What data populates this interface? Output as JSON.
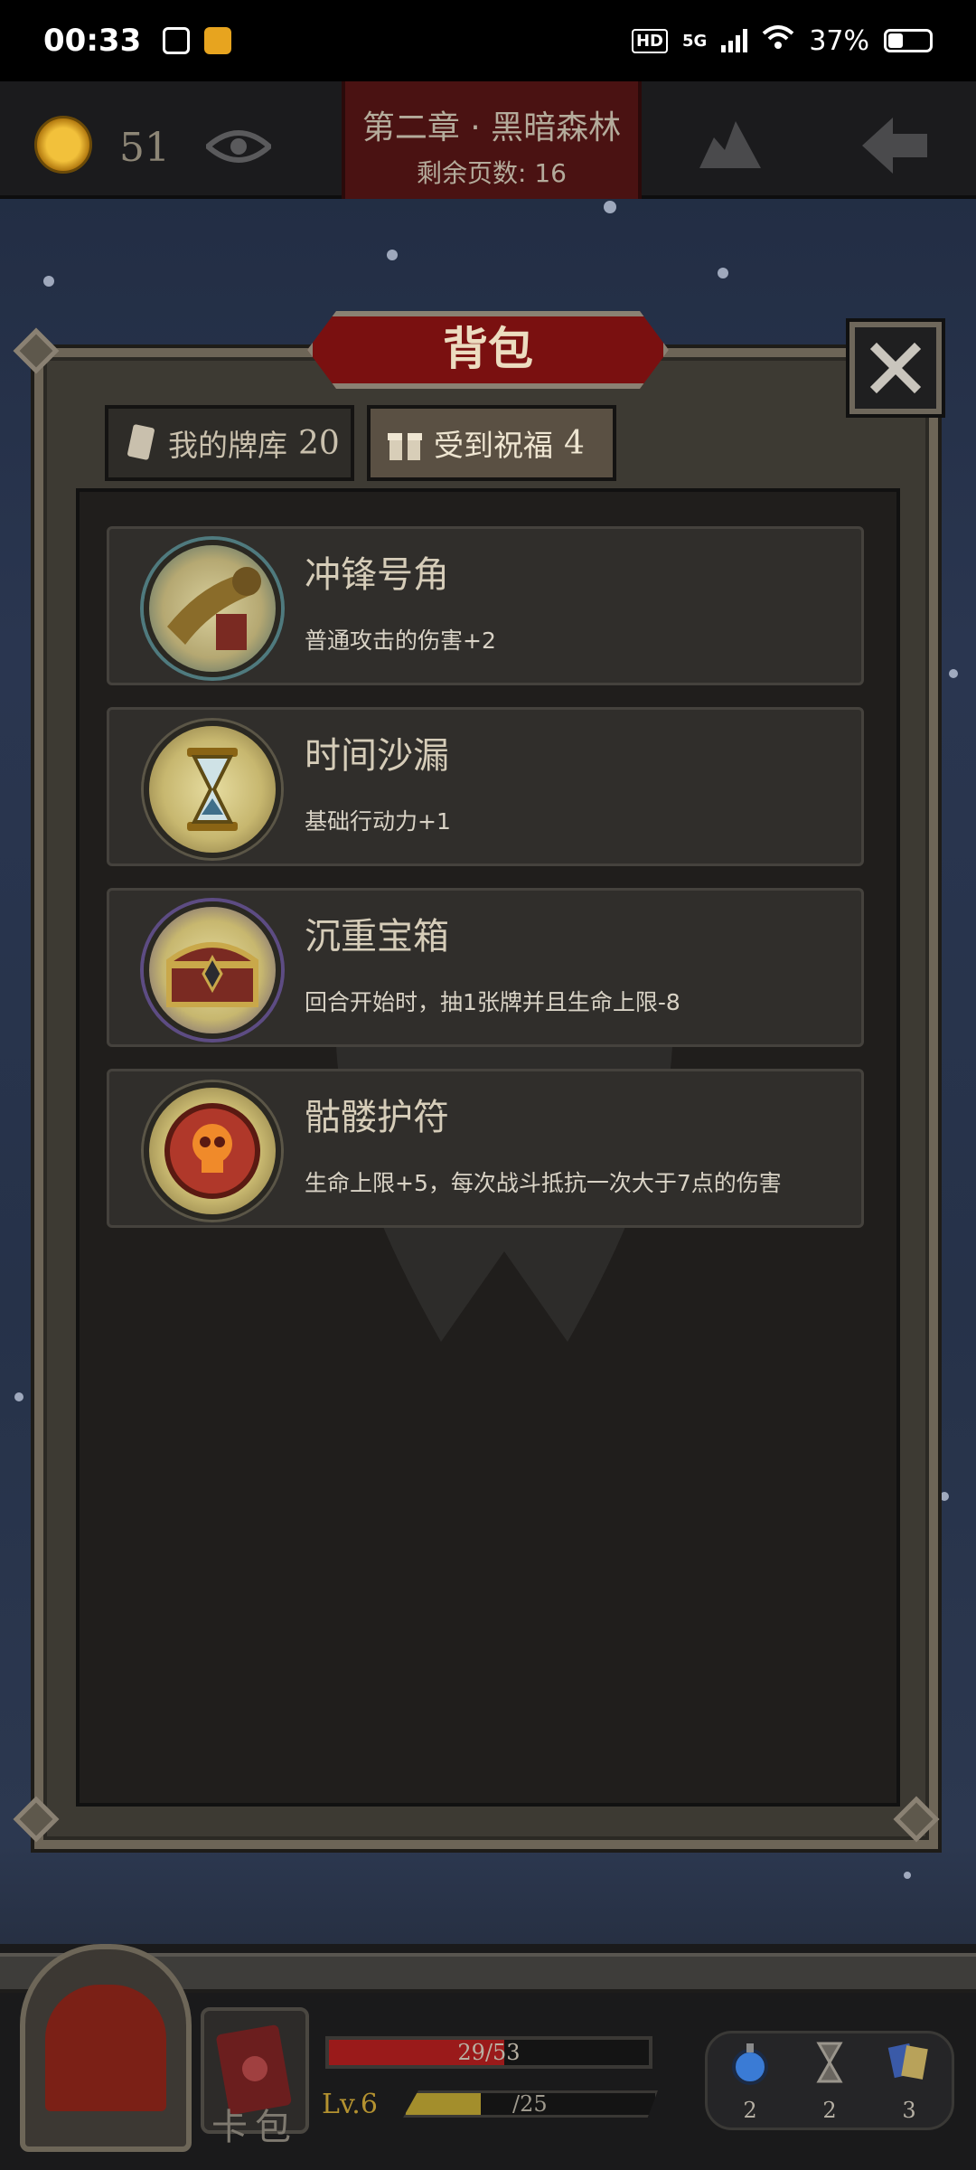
{
  "status_bar": {
    "time": "00:33",
    "network": "5G",
    "hd_label": "HD",
    "battery": "37%"
  },
  "top_bar": {
    "coins": "51",
    "chapter_title": "第二章 · 黑暗森林",
    "pages_remaining": "剩余页数: 16"
  },
  "panel": {
    "title": "背包",
    "tabs": [
      {
        "label": "我的牌库",
        "count": "20",
        "icon": "card-icon",
        "active": false
      },
      {
        "label": "受到祝福",
        "count": "4",
        "icon": "gift-icon",
        "active": true
      }
    ],
    "items": [
      {
        "name": "冲锋号角",
        "desc": "普通攻击的伤害+2",
        "icon": "horn-icon"
      },
      {
        "name": "时间沙漏",
        "desc": "基础行动力+1",
        "icon": "hourglass-icon"
      },
      {
        "name": "沉重宝箱",
        "desc": "回合开始时，抽1张牌并且生命上限-8",
        "icon": "chest-icon"
      },
      {
        "name": "骷髅护符",
        "desc": "生命上限+5，每次战斗抵抗一次大于7点的伤害",
        "icon": "skull-amulet-icon"
      }
    ]
  },
  "hud": {
    "deck_label": "卡包",
    "hp_text": "29/53",
    "hp": 29,
    "hp_max": 53,
    "level": "Lv.6",
    "xp_text": "/25",
    "xp_fraction": 0.3,
    "resources": [
      {
        "icon": "potion-icon",
        "count": "2"
      },
      {
        "icon": "hourglass-icon",
        "count": "2"
      },
      {
        "icon": "cards-icon",
        "count": "3"
      }
    ]
  },
  "colors": {
    "banner_red": "#7a1010",
    "hp_red": "#9a1a1a",
    "xp_gold": "#a38e2c",
    "coin_gold": "#f2c13b"
  }
}
